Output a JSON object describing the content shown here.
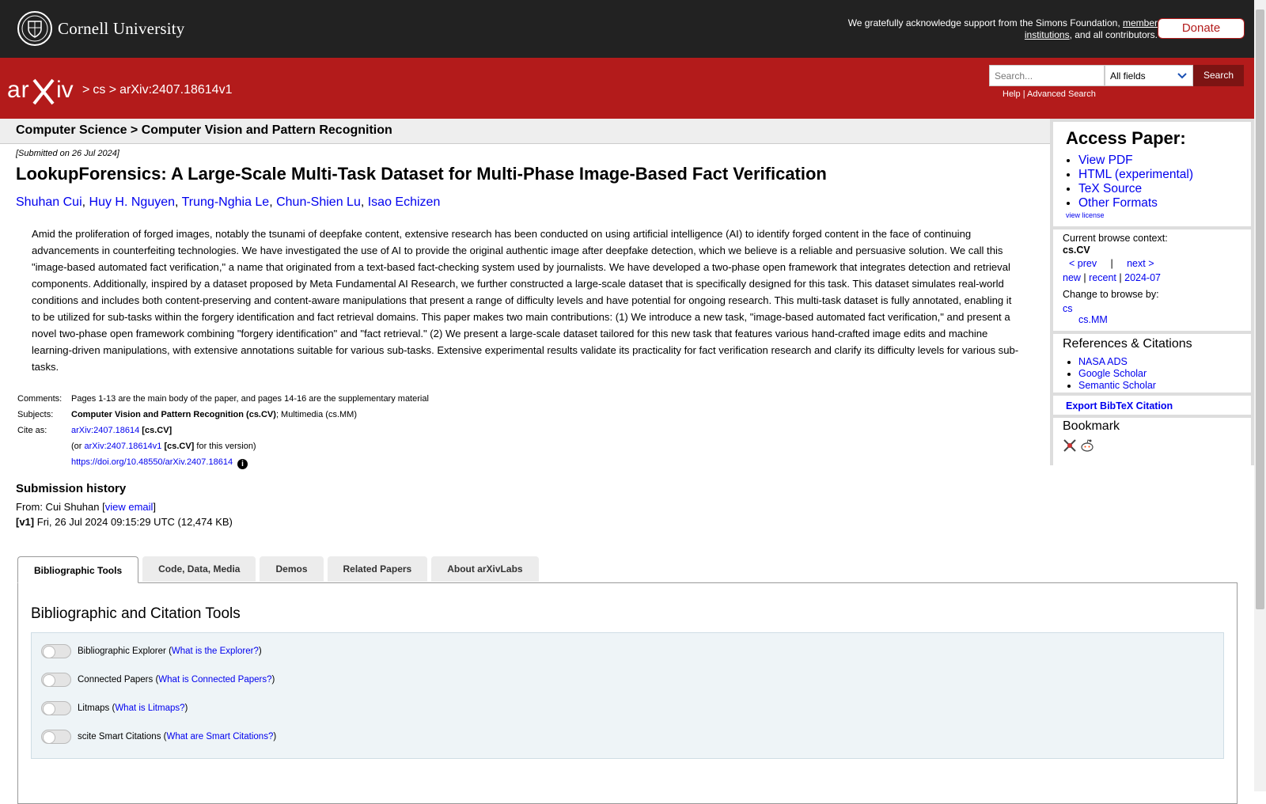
{
  "header": {
    "cornell_name": "Cornell University",
    "support_text_pre": "We gratefully acknowledge support from the Simons Foundation, ",
    "support_link": "member institutions",
    "support_text_post": ", and all contributors.",
    "donate_label": "Donate"
  },
  "nav": {
    "sep1": ">",
    "crumb_cs": "cs",
    "sep2": ">",
    "crumb_id": "arXiv:2407.18614v1",
    "search_placeholder": "Search...",
    "search_field": "All fields",
    "search_button": "Search",
    "help": "Help",
    "help_sep": "|",
    "advanced": "Advanced Search"
  },
  "subheader": "Computer Science > Computer Vision and Pattern Recognition",
  "paper": {
    "submitted": "[Submitted on 26 Jul 2024]",
    "title": "LookupForensics: A Large-Scale Multi-Task Dataset for Multi-Phase Image-Based Fact Verification",
    "authors": [
      "Shuhan Cui",
      "Huy H. Nguyen",
      "Trung-Nghia Le",
      "Chun-Shien Lu",
      "Isao Echizen"
    ],
    "abstract": "Amid the proliferation of forged images, notably the tsunami of deepfake content, extensive research has been conducted on using artificial intelligence (AI) to identify forged content in the face of continuing advancements in counterfeiting technologies. We have investigated the use of AI to provide the original authentic image after deepfake detection, which we believe is a reliable and persuasive solution. We call this \"image-based automated fact verification,\" a name that originated from a text-based fact-checking system used by journalists. We have developed a two-phase open framework that integrates detection and retrieval components. Additionally, inspired by a dataset proposed by Meta Fundamental AI Research, we further constructed a large-scale dataset that is specifically designed for this task. This dataset simulates real-world conditions and includes both content-preserving and content-aware manipulations that present a range of difficulty levels and have potential for ongoing research. This multi-task dataset is fully annotated, enabling it to be utilized for sub-tasks within the forgery identification and fact retrieval domains. This paper makes two main contributions: (1) We introduce a new task, \"image-based automated fact verification,\" and present a novel two-phase open framework combining \"forgery identification\" and \"fact retrieval.\" (2) We present a large-scale dataset tailored for this new task that features various hand-crafted image edits and machine learning-driven manipulations, with extensive annotations suitable for various sub-tasks. Extensive experimental results validate its practicality for fact verification research and clarify its difficulty levels for various sub-tasks."
  },
  "meta": {
    "comments_label": "Comments:",
    "comments": "Pages 1-13 are the main body of the paper, and pages 14-16 are the supplementary material",
    "subjects_label": "Subjects:",
    "subjects_primary": "Computer Vision and Pattern Recognition (cs.CV)",
    "subjects_rest": "; Multimedia (cs.MM)",
    "cite_label": "Cite as:",
    "cite_id": "arXiv:2407.18614",
    "cite_cat": "[cs.CV]",
    "cite_or": "(or",
    "cite_version": "arXiv:2407.18614v1",
    "cite_version_cat": "[cs.CV]",
    "cite_version_post": "for this version)",
    "doi": "https://doi.org/10.48550/arXiv.2407.18614",
    "info_glyph": "i"
  },
  "history": {
    "heading": "Submission history",
    "from_pre": "From: Cui Shuhan [",
    "view_email": "view email",
    "from_post": "]",
    "v1_label": "[v1]",
    "v1_text": "Fri, 26 Jul 2024 09:15:29 UTC (12,474 KB)"
  },
  "tabs": [
    "Bibliographic Tools",
    "Code, Data, Media",
    "Demos",
    "Related Papers",
    "About arXivLabs"
  ],
  "tools": {
    "title": "Bibliographic and Citation Tools",
    "items": [
      {
        "label": "Bibliographic Explorer",
        "link": "What is the Explorer?"
      },
      {
        "label": "Connected Papers",
        "link": "What is Connected Papers?"
      },
      {
        "label": "Litmaps",
        "link": "What is Litmaps?"
      },
      {
        "label": "scite Smart Citations",
        "link": "What are Smart Citations?"
      }
    ]
  },
  "sidebar": {
    "access_heading": "Access Paper:",
    "access_links": [
      "View PDF",
      "HTML (experimental)",
      "TeX Source",
      "Other Formats"
    ],
    "view_license": "view license",
    "context_label": "Current browse context:",
    "context_value": "cs.CV",
    "prev": "< prev",
    "pipe": "|",
    "next": "next >",
    "new": "new",
    "recent": "recent",
    "month": "2024-07",
    "change_label": "Change to browse by:",
    "browse_cs": "cs",
    "browse_mm": "cs.MM",
    "refs_heading": "References & Citations",
    "refs": [
      "NASA ADS",
      "Google Scholar",
      "Semantic Scholar"
    ],
    "export_bibtex": "Export BibTeX Citation",
    "bookmark_heading": "Bookmark"
  },
  "colors": {
    "arxiv_red": "#b31b1b",
    "top_bar": "#222222",
    "link_blue": "#0000ee"
  }
}
